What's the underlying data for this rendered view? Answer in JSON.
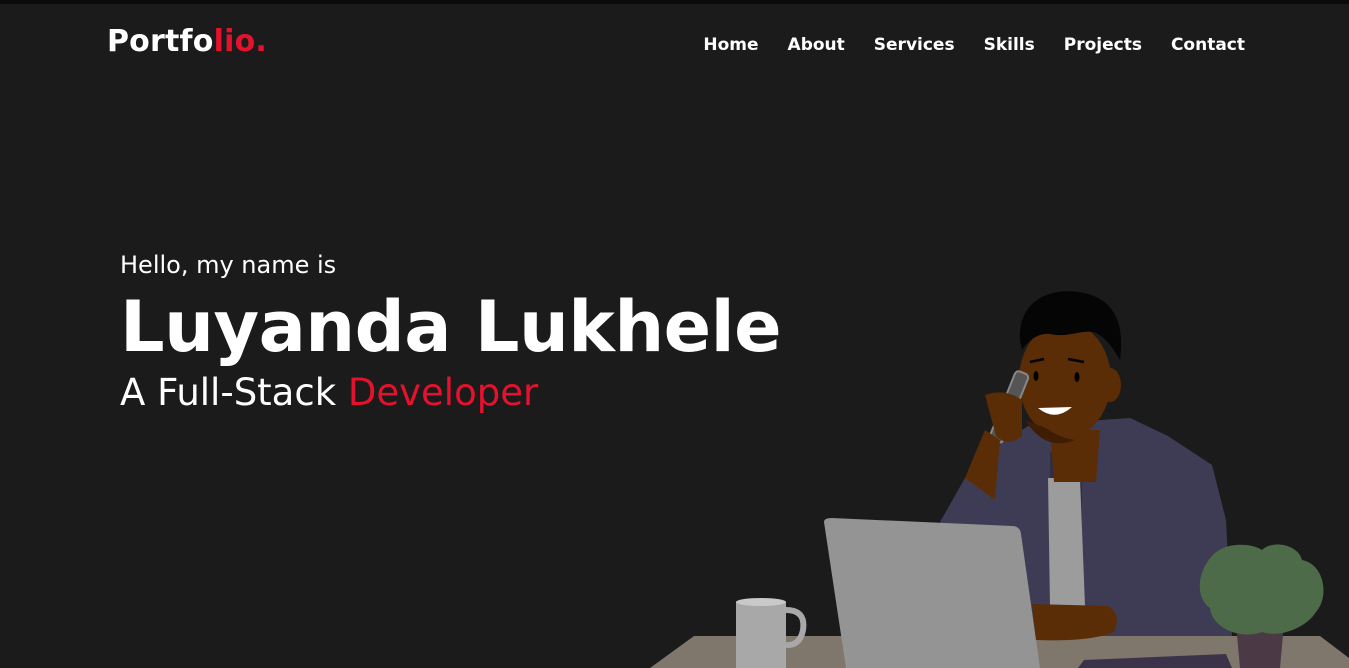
{
  "logo": {
    "text_main": "Portfo",
    "text_accent": "lio."
  },
  "nav": {
    "items": [
      "Home",
      "About",
      "Services",
      "Skills",
      "Projects",
      "Contact"
    ]
  },
  "hero": {
    "greeting": "Hello, my name is",
    "name": "Luyanda Lukhele",
    "role_prefix": "A Full-Stack ",
    "role_highlight": "Developer"
  },
  "colors": {
    "background": "#1b1b1b",
    "accent": "#e5112d",
    "text": "#ffffff"
  }
}
